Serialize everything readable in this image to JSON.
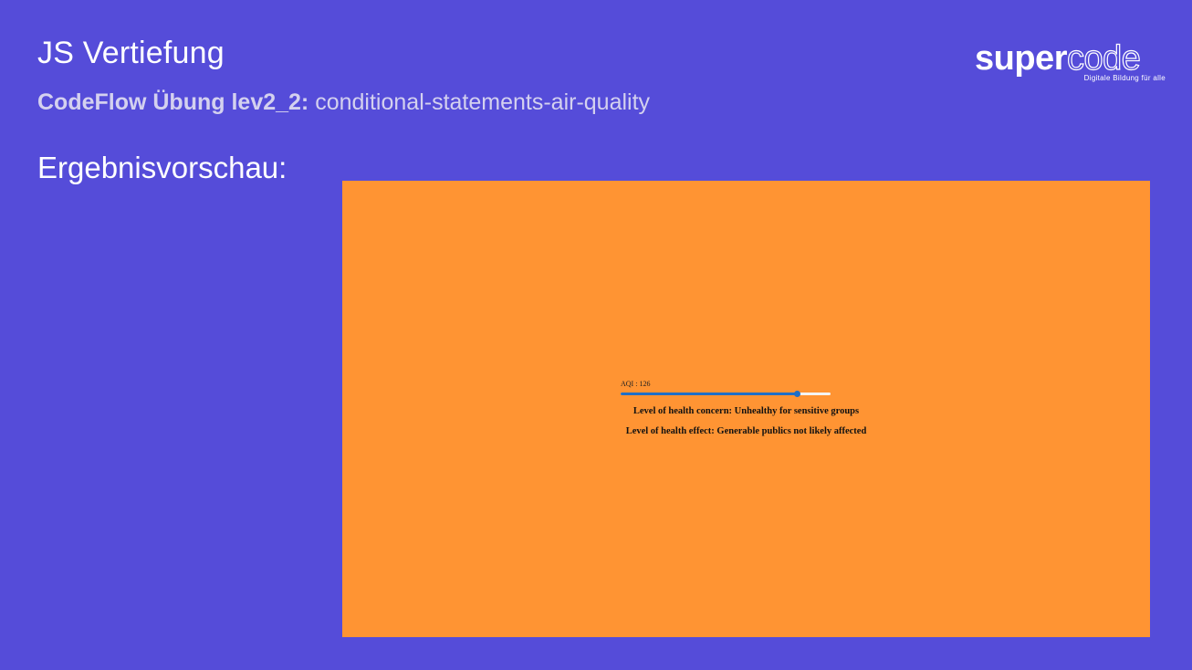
{
  "header": {
    "title": "JS Vertiefung",
    "subtitle_bold": "CodeFlow Übung lev2_2:",
    "subtitle_normal": " conditional-statements-air-quality"
  },
  "section": {
    "label": "Ergebnisvorschau:"
  },
  "logo": {
    "word_solid": "super",
    "word_outline": "code",
    "tagline": "Digitale Bildung für alle"
  },
  "preview": {
    "aqi_label": "AQI : 126",
    "aqi_value": 126,
    "slider_fill_fraction": 0.84,
    "health_concern": "Level of health concern: Unhealthy for sensitive groups",
    "health_effect": "Level of health effect: Generable publics not likely affected"
  },
  "colors": {
    "background": "#554cd9",
    "preview_background": "#ff9433",
    "slider_accent": "#1f6fc7"
  }
}
